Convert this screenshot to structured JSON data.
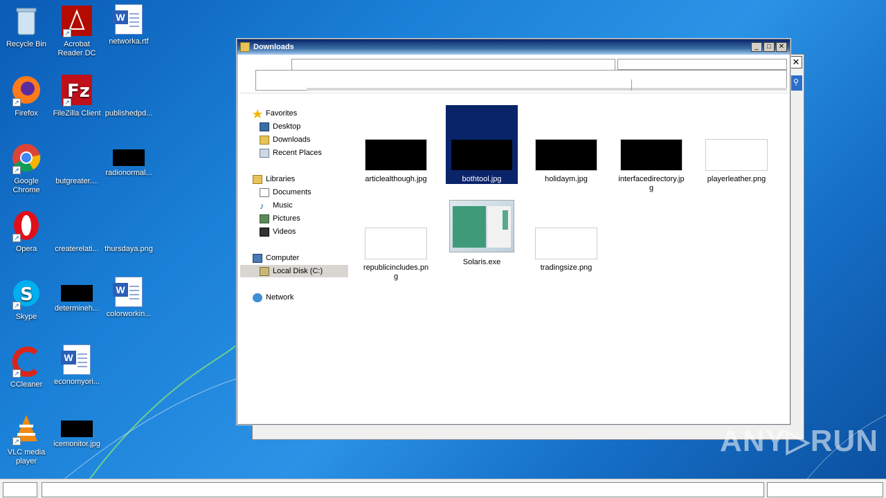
{
  "desktop": {
    "icons": [
      {
        "label": "Recycle Bin",
        "icon": "recycle-bin-icon"
      },
      {
        "label": "Acrobat Reader DC",
        "icon": "acrobat-icon"
      },
      {
        "label": "networka.rtf",
        "icon": "word-doc-icon"
      },
      {
        "label": "Firefox",
        "icon": "firefox-icon"
      },
      {
        "label": "FileZilla Client",
        "icon": "filezilla-icon"
      },
      {
        "label": "publishedpd...",
        "icon": "file-icon"
      },
      {
        "label": "Google Chrome",
        "icon": "chrome-icon"
      },
      {
        "label": "butgreater....",
        "icon": "file-icon"
      },
      {
        "label": "radionormal...",
        "icon": "image-icon"
      },
      {
        "label": "Opera",
        "icon": "opera-icon"
      },
      {
        "label": "createrelati...",
        "icon": "file-icon"
      },
      {
        "label": "thursdaya.png",
        "icon": "file-icon"
      },
      {
        "label": "Skype",
        "icon": "skype-icon"
      },
      {
        "label": "determineh...",
        "icon": "image-icon"
      },
      {
        "label": "colorworkin...",
        "icon": "word-doc-icon"
      },
      {
        "label": "CCleaner",
        "icon": "ccleaner-icon"
      },
      {
        "label": "economyori...",
        "icon": "word-doc-icon"
      },
      {
        "label": "VLC media player",
        "icon": "vlc-icon"
      },
      {
        "label": "icemonitor.jpg",
        "icon": "image-icon"
      }
    ]
  },
  "window": {
    "title": "Downloads",
    "buttons": {
      "minimize": "_",
      "maximize": "□",
      "close": "✕"
    },
    "back_close": "✕",
    "back_search": "⚲"
  },
  "nav": {
    "favorites": "Favorites",
    "desktop": "Desktop",
    "downloads": "Downloads",
    "recent": "Recent Places",
    "libraries": "Libraries",
    "documents": "Documents",
    "music": "Music",
    "pictures": "Pictures",
    "videos": "Videos",
    "computer": "Computer",
    "local_disk": "Local Disk (C:)",
    "network": "Network"
  },
  "files": [
    {
      "name": "articlealthough.jpg"
    },
    {
      "name": "bothtool.jpg",
      "selected": true
    },
    {
      "name": "holidaym.jpg"
    },
    {
      "name": "interfacedirectory.jpg"
    },
    {
      "name": "playerleather.png"
    },
    {
      "name": "republicincludes.png"
    },
    {
      "name": "Solaris.exe"
    },
    {
      "name": "tradingsize.png"
    }
  ],
  "watermark": "ANY▷RUN",
  "colors": {
    "selection": "#0a246a",
    "title_start": "#0a246a",
    "title_end": "#a6caf0"
  }
}
